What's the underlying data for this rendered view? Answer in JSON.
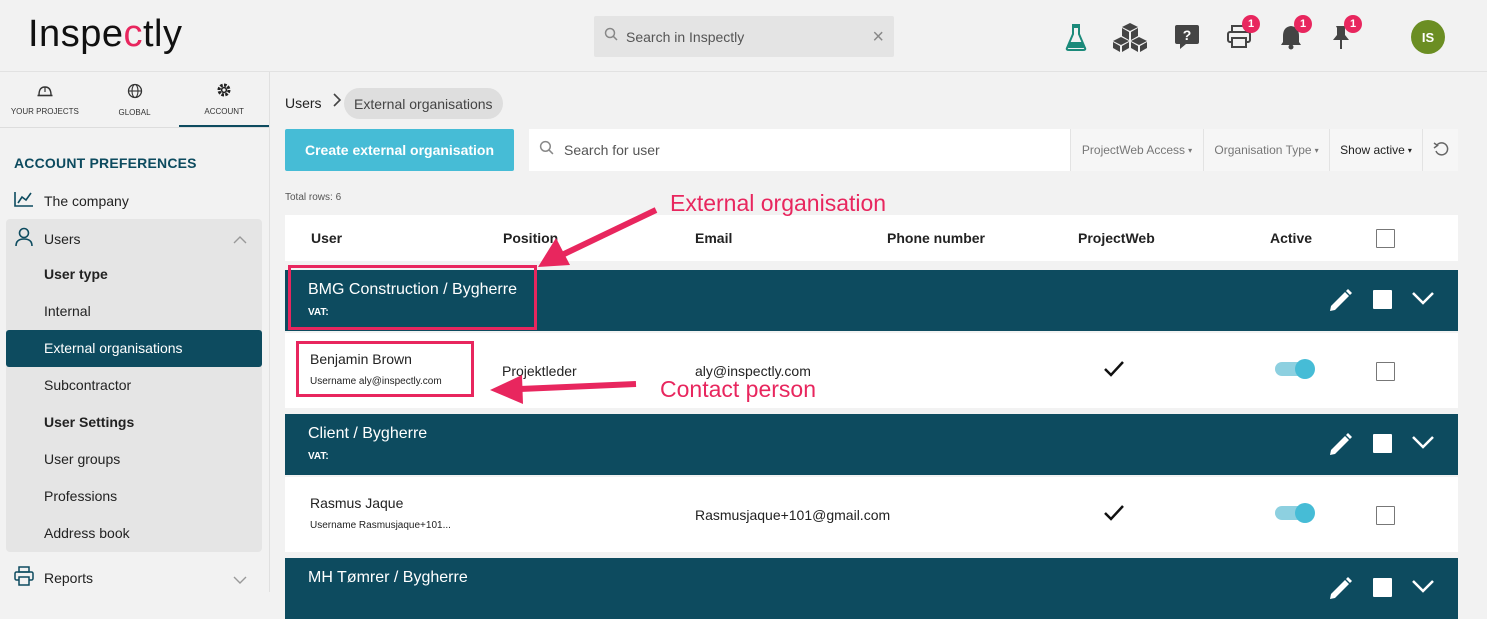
{
  "header": {
    "logo_text_1": "Inspe",
    "logo_text_q": "c",
    "logo_text_2": "tly",
    "search_placeholder": "Search in Inspectly",
    "badges": {
      "print": "1",
      "bell": "1",
      "pin": "1"
    },
    "avatar_initials": "IS"
  },
  "sidebar": {
    "tabs": [
      {
        "label": "YOUR PROJECTS",
        "icon": "helmet-icon"
      },
      {
        "label": "GLOBAL",
        "icon": "globe-icon"
      },
      {
        "label": "ACCOUNT",
        "icon": "gear-icon"
      }
    ],
    "section_title": "ACCOUNT PREFERENCES",
    "items": {
      "company": "The company",
      "users": "Users",
      "user_type": "User type",
      "internal": "Internal",
      "external": "External organisations",
      "subcontractor": "Subcontractor",
      "user_settings": "User Settings",
      "user_groups": "User groups",
      "professions": "Professions",
      "address_book": "Address book",
      "reports": "Reports"
    }
  },
  "main": {
    "breadcrumb": [
      "Users",
      "External organisations"
    ],
    "create_button": "Create external organisation",
    "search_placeholder": "Search for user",
    "filters": {
      "projectweb_access": "ProjectWeb Access",
      "organisation_type": "Organisation Type",
      "show_active": "Show active"
    },
    "total_rows": "Total rows: 6",
    "columns": [
      "User",
      "Position",
      "Email",
      "Phone number",
      "ProjectWeb",
      "Active"
    ],
    "organisations": [
      {
        "name": "BMG Construction / Bygherre",
        "vat": "VAT:",
        "contact": {
          "name": "Benjamin Brown",
          "username": "Username aly@inspectly.com",
          "position": "Projektleder",
          "email": "aly@inspectly.com",
          "projectweb": true,
          "active": true
        }
      },
      {
        "name": "Client / Bygherre",
        "vat": "VAT:",
        "contact": {
          "name": "Rasmus Jaque",
          "username": "Username Rasmusjaque+101...",
          "position": "",
          "email": "Rasmusjaque+101@gmail.com",
          "projectweb": true,
          "active": true
        }
      },
      {
        "name": "MH Tømrer / Bygherre"
      }
    ]
  },
  "annotations": {
    "external_org": "External organisation",
    "contact_person": "Contact person"
  },
  "colors": {
    "brand_pink": "#e8265e",
    "teal_dark": "#0d4b5f",
    "accent_cyan": "#46bcd6"
  }
}
